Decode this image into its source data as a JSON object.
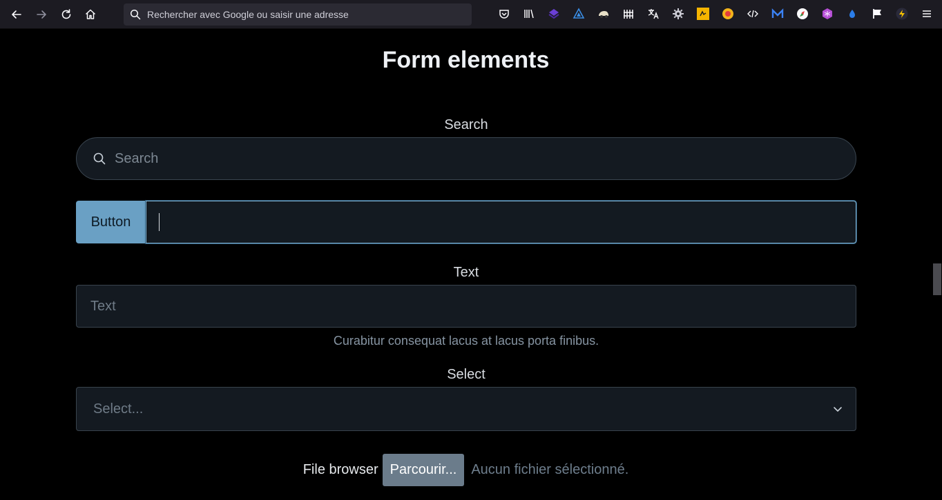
{
  "browser": {
    "url_placeholder": "Rechercher avec Google ou saisir une adresse"
  },
  "page": {
    "title": "Form elements",
    "search": {
      "label": "Search",
      "placeholder": "Search"
    },
    "button_group": {
      "button_label": "Button",
      "input_value": ""
    },
    "text": {
      "label": "Text",
      "placeholder": "Text",
      "help": "Curabitur consequat lacus at lacus porta finibus."
    },
    "select": {
      "label": "Select",
      "value": "Select..."
    },
    "file": {
      "label": "File browser",
      "button_label": "Parcourir...",
      "status": "Aucun fichier sélectionné."
    }
  },
  "colors": {
    "toolbar_bg": "#1c1b22",
    "page_bg": "#000000",
    "field_bg": "#141a21",
    "accent_button": "#6aa0c4",
    "file_button": "#6b7c8b"
  },
  "extensions": [
    "pocket-icon",
    "library-icon",
    "purple-stack-icon",
    "triangle-icon",
    "car-icon",
    "fence-icon",
    "translate-icon",
    "gear-icon",
    "folder-icon",
    "color-wheel-icon",
    "code-icon",
    "m-icon",
    "compass-icon",
    "cube-icon",
    "drop-icon",
    "flag-icon",
    "bolt-icon",
    "menu-icon"
  ]
}
